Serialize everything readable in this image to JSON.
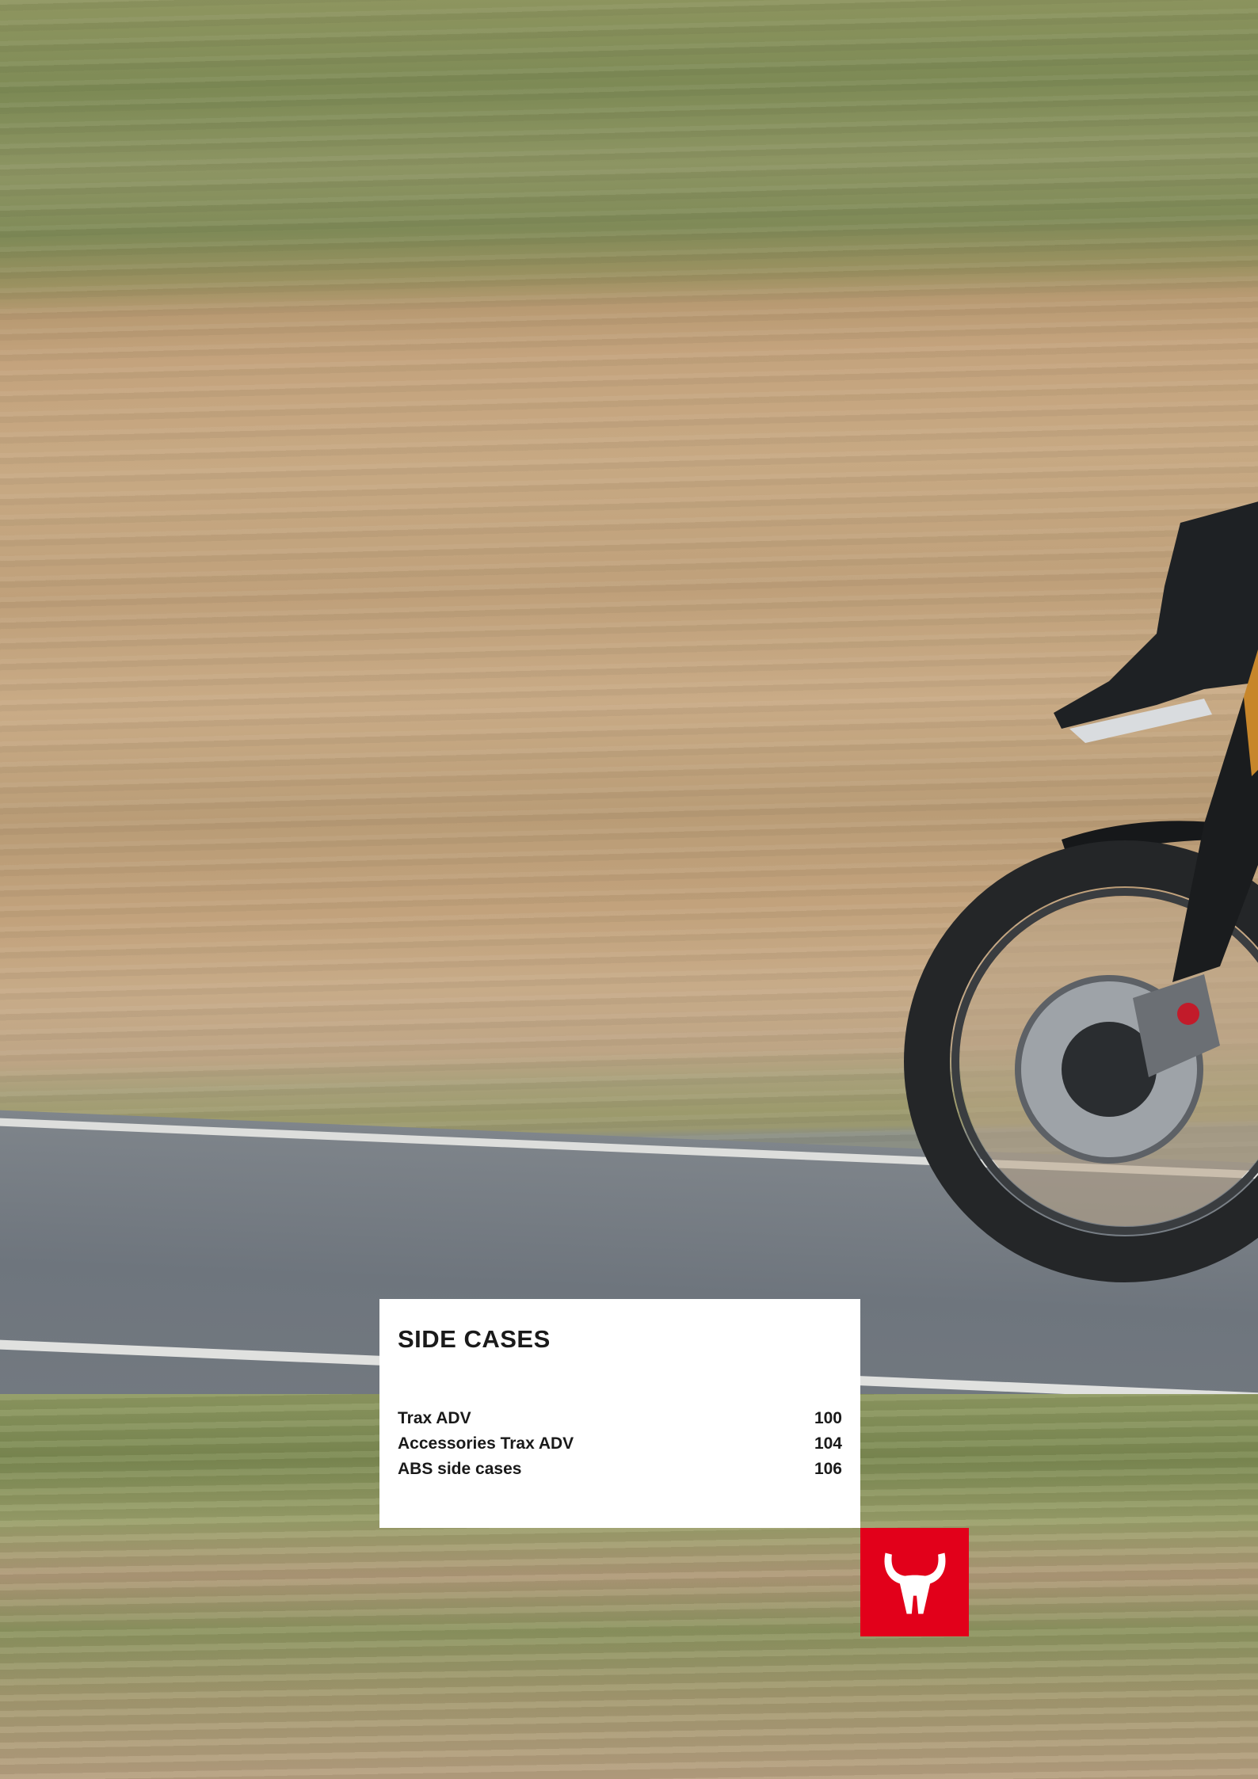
{
  "colors": {
    "brand_red": "#e2001a",
    "panel_bg": "#ffffff",
    "text": "#1a1a1a"
  },
  "section": {
    "title": "SIDE CASES"
  },
  "toc": [
    {
      "label": "Trax ADV",
      "page": "100"
    },
    {
      "label": "Accessories Trax ADV",
      "page": "104"
    },
    {
      "label": "ABS side cases",
      "page": "106"
    }
  ],
  "brand": {
    "logo_icon": "bull-head-icon"
  },
  "photo": {
    "subject_icon": "motorcycle-front-wheel-icon"
  }
}
